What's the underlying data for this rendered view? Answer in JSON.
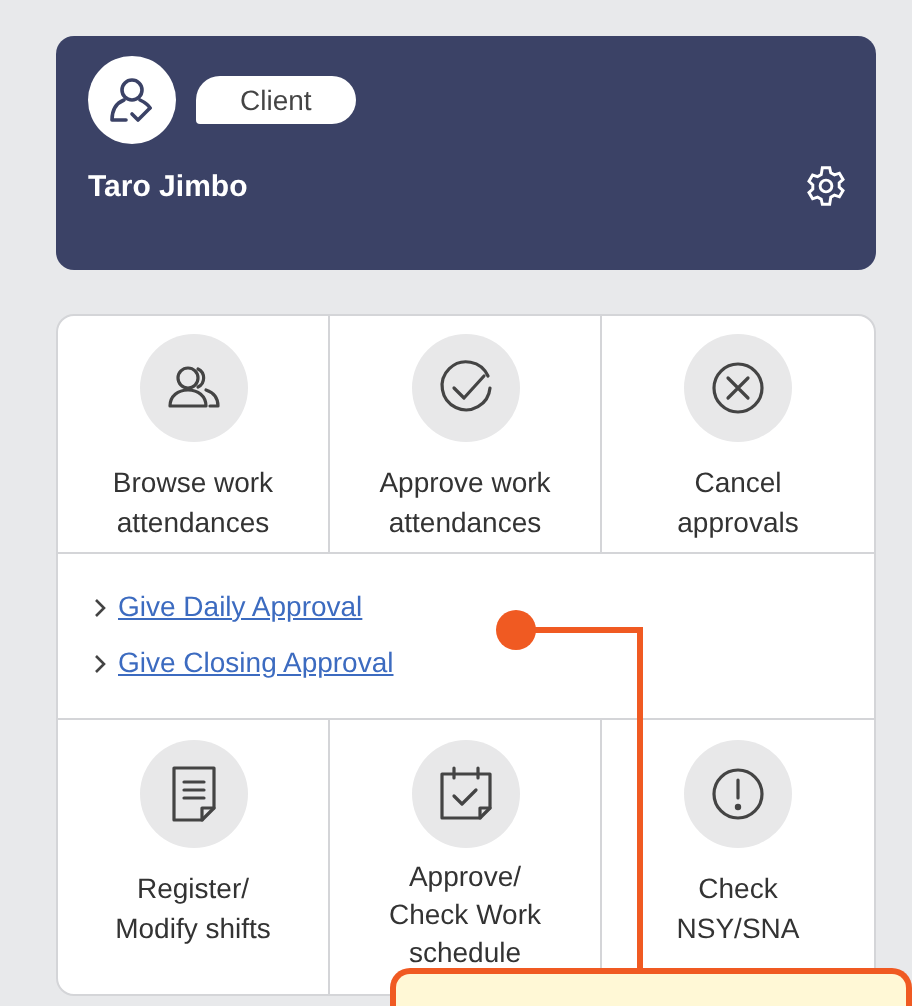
{
  "profile": {
    "role": "Client",
    "name": "Taro Jimbo"
  },
  "tiles_top": [
    {
      "label": "Browse work attendances"
    },
    {
      "label": "Approve work attendances"
    },
    {
      "label": "Cancel approvals"
    }
  ],
  "links": [
    {
      "label": "Give Daily Approval"
    },
    {
      "label": "Give Closing Approval"
    }
  ],
  "tiles_bottom": [
    {
      "label": "Register/ Modify shifts"
    },
    {
      "label": "Approve/ Check Work schedule"
    },
    {
      "label": "Check NSY/SNA"
    }
  ]
}
